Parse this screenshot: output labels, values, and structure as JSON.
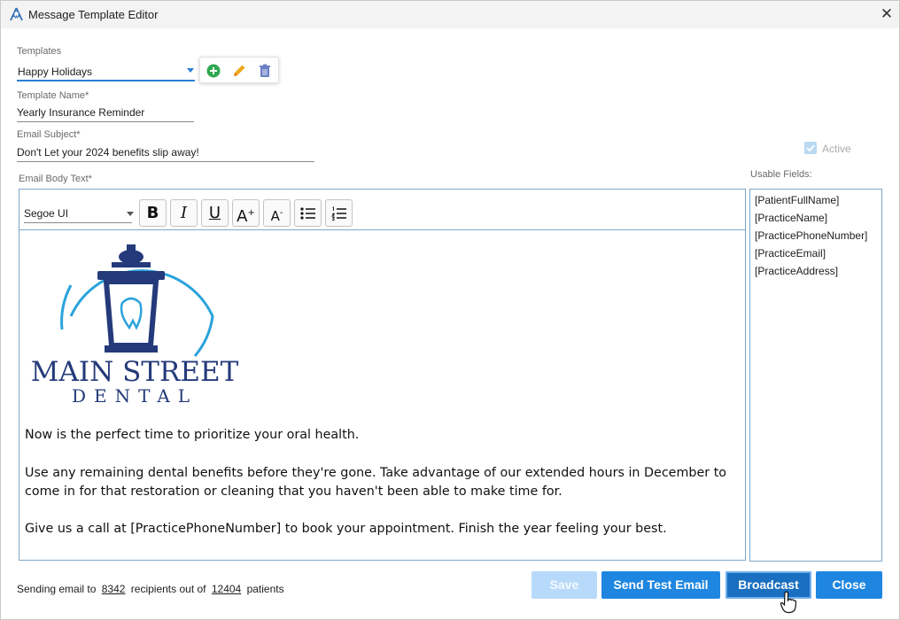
{
  "window": {
    "title": "Message Template Editor",
    "close_icon": "close-icon"
  },
  "templates": {
    "label": "Templates",
    "selected": "Happy Holidays",
    "toolbar_icons": [
      "add-icon",
      "edit-pencil-icon",
      "delete-trash-icon"
    ],
    "colors": {
      "add": "#2fa84f",
      "edit": "#e8a21a",
      "delete": "#6b7ec4"
    }
  },
  "template_name": {
    "label": "Template Name*",
    "value": "Yearly Insurance Reminder"
  },
  "email_subject": {
    "label": "Email Subject*",
    "value": "Don't Let your 2024 benefits slip away!"
  },
  "active": {
    "label": "Active",
    "checked": true,
    "enabled": false
  },
  "body": {
    "label": "Email Body Text*",
    "font": "Segoe UI",
    "format_buttons": [
      {
        "name": "bold",
        "glyph": "B"
      },
      {
        "name": "italic",
        "glyph": "I"
      },
      {
        "name": "underline",
        "glyph": "U"
      },
      {
        "name": "increase-font-size",
        "glyph": "A+"
      },
      {
        "name": "decrease-font-size",
        "glyph": "A-"
      },
      {
        "name": "bullet-list",
        "glyph": "bullets"
      },
      {
        "name": "numbered-list",
        "glyph": "numbers"
      }
    ],
    "logo": {
      "line1": "MAIN STREET",
      "line2": "DENTAL",
      "color": "#243a7a",
      "ring_color": "#2aa3dc"
    },
    "paragraphs": [
      "Now is the perfect time to prioritize your oral health.",
      "Use any remaining dental benefits before they're gone. Take advantage of our extended hours in December to come in for that restoration or cleaning that you haven't been able to make time for.",
      "Give us a call at [PracticePhoneNumber] to book your appointment. Finish the year feeling your best."
    ]
  },
  "usable_fields": {
    "label": "Usable Fields:",
    "items": [
      "[PatientFullName]",
      "[PracticeName]",
      "[PracticePhoneNumber]",
      "[PracticeEmail]",
      "[PracticeAddress]"
    ]
  },
  "footer": {
    "prefix": "Sending email to",
    "recipients": "8342",
    "middle": "recipients out of",
    "total": "12404",
    "suffix": "patients"
  },
  "buttons": {
    "save": "Save",
    "send_test": "Send Test Email",
    "broadcast": "Broadcast",
    "close": "Close"
  },
  "colors": {
    "accent": "#1e86e0",
    "accent_disabled": "#b8dafa"
  }
}
